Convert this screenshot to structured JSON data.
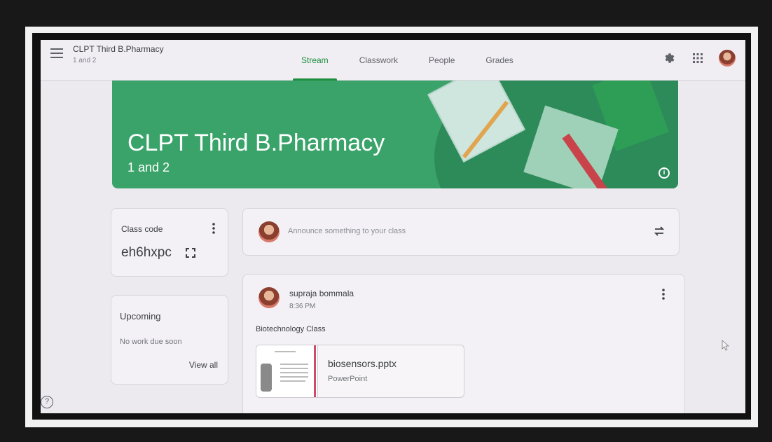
{
  "header": {
    "class_title": "CLPT Third B.Pharmacy",
    "class_sub": "1 and 2"
  },
  "tabs": [
    {
      "label": "Stream",
      "active": true
    },
    {
      "label": "Classwork",
      "active": false
    },
    {
      "label": "People",
      "active": false
    },
    {
      "label": "Grades",
      "active": false
    }
  ],
  "icons": {
    "menu": "menu-icon",
    "settings": "settings-icon",
    "apps": "apps-grid-icon",
    "info": "info-icon",
    "more": "more-vert-icon",
    "expand": "fullscreen-icon",
    "repost": "repost-icon",
    "help": "help-icon"
  },
  "banner": {
    "title": "CLPT Third B.Pharmacy",
    "subtitle": "1 and 2",
    "color": "#3aa36a"
  },
  "class_code": {
    "label": "Class code",
    "code": "eh6hxpc"
  },
  "upcoming": {
    "title": "Upcoming",
    "text": "No work due soon",
    "view_all": "View all"
  },
  "announce": {
    "placeholder": "Announce something to your class"
  },
  "post": {
    "author": "supraja bommala",
    "time": "8:36 PM",
    "text": "Biotechnology Class",
    "attachment": {
      "name": "biosensors.pptx",
      "type": "PowerPoint"
    }
  },
  "colors": {
    "accent": "#1e8e3e",
    "banner": "#3aa36a"
  }
}
